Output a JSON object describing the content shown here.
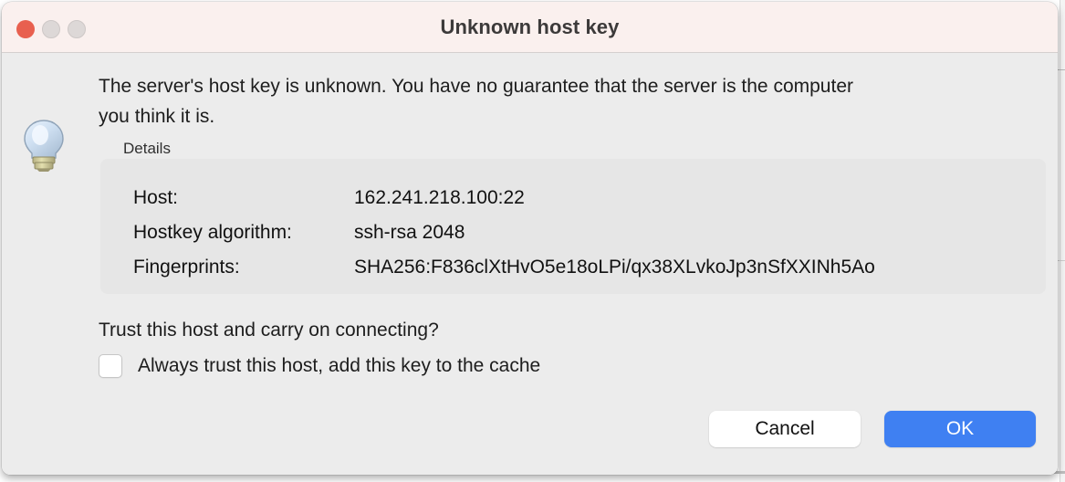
{
  "window": {
    "title": "Unknown host key",
    "traffic_lights": [
      {
        "name": "close",
        "color": "#e8604f",
        "active": true
      },
      {
        "name": "minimize",
        "color": "#ddd8d7",
        "active": false
      },
      {
        "name": "maximize",
        "color": "#ddd8d7",
        "active": false
      }
    ],
    "titlebar_color": "#faf0ee",
    "background_color": "#ececec"
  },
  "icon": {
    "name": "lightbulb-icon",
    "glass_color": "#cfe0f2",
    "base_color": "#c7c291"
  },
  "message": "The server's host key is unknown. You have no guarantee that the server is the computer you think it is.",
  "details": {
    "label": "Details",
    "panel_color": "#e6e6e6",
    "rows": [
      {
        "key": "Host:",
        "value": "162.241.218.100:22"
      },
      {
        "key": "Hostkey algorithm:",
        "value": "ssh-rsa 2048"
      },
      {
        "key": "Fingerprints:",
        "value": "SHA256:F836clXtHvO5e18oLPi/qx38XLvkoJp3nSfXXINh5Ao"
      }
    ]
  },
  "trust": {
    "question": "Trust this host and carry on connecting?",
    "checkbox_label": "Always trust this host, add this key to the cache",
    "checkbox_checked": false
  },
  "buttons": {
    "cancel": "Cancel",
    "ok": "OK",
    "ok_color": "#3f80f2"
  }
}
